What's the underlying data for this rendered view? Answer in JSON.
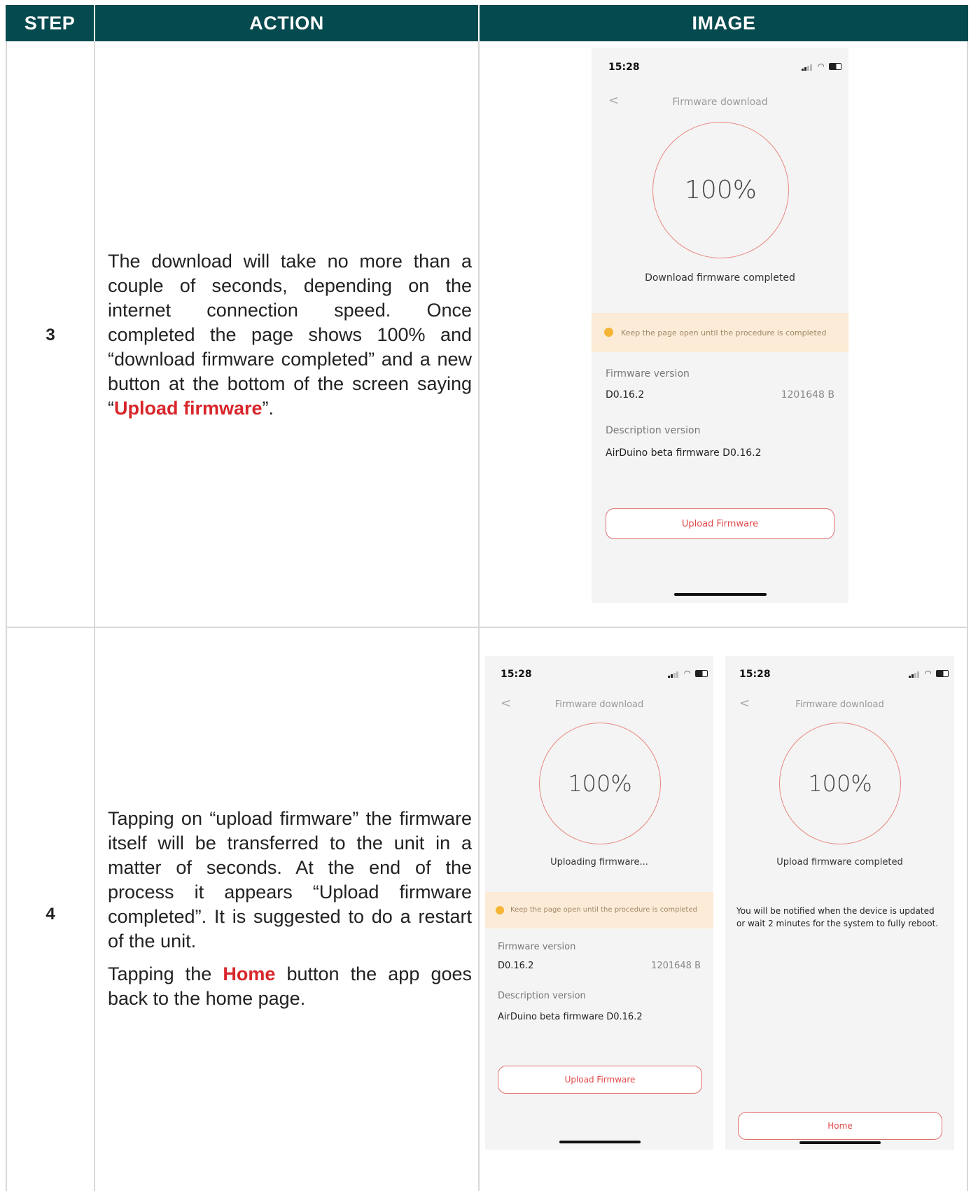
{
  "headers": {
    "step": "STEP",
    "action": "ACTION",
    "image": "IMAGE"
  },
  "rows": [
    {
      "step": "3",
      "action_parts": [
        "The download will take no more than a couple of seconds, depending on the internet connection speed. Once completed  the page shows 100% and “download firmware completed” and a new button at the bottom of the screen saying “",
        "Upload firmware",
        "”."
      ]
    },
    {
      "step": "4",
      "action_p1": "Tapping on “upload firmware” the firmware itself will be transferred to the unit in a matter of seconds. At the end of the process it appears “Upload firmware completed”. It is suggested to do a restart of the unit.",
      "action_p2_parts": [
        "Tapping the ",
        "Home",
        " button the app goes back to the home page."
      ]
    }
  ],
  "phone_common": {
    "time": "15:28",
    "back": "<",
    "title": "Firmware download",
    "percent": "100%",
    "warning": "Keep the page open until the procedure is completed",
    "fw_version_label": "Firmware version",
    "fw_version": "D0.16.2",
    "fw_size": "1201648 B",
    "desc_label": "Description version",
    "desc_value": "AirDuino beta firmware D0.16.2",
    "upload_button": "Upload Firmware"
  },
  "phone1": {
    "status_msg": "Download firmware completed"
  },
  "phone2": {
    "status_msg": "Uploading firmware..."
  },
  "phone3": {
    "status_msg": "Upload firmware completed",
    "note_line1": "You will be notified when the device is updated",
    "note_line2": "or wait 2 minutes for the system to fully reboot.",
    "home_button": "Home"
  },
  "colors": {
    "header_bg": "#054a4e",
    "highlight": "#d8262b",
    "ring": "#e88880",
    "warning_bg": "#fcebd7"
  },
  "icons": {
    "signal": "signal-icon",
    "wifi": "wifi-icon",
    "battery": "battery-icon",
    "warning_dot": "warning-dot-icon"
  }
}
